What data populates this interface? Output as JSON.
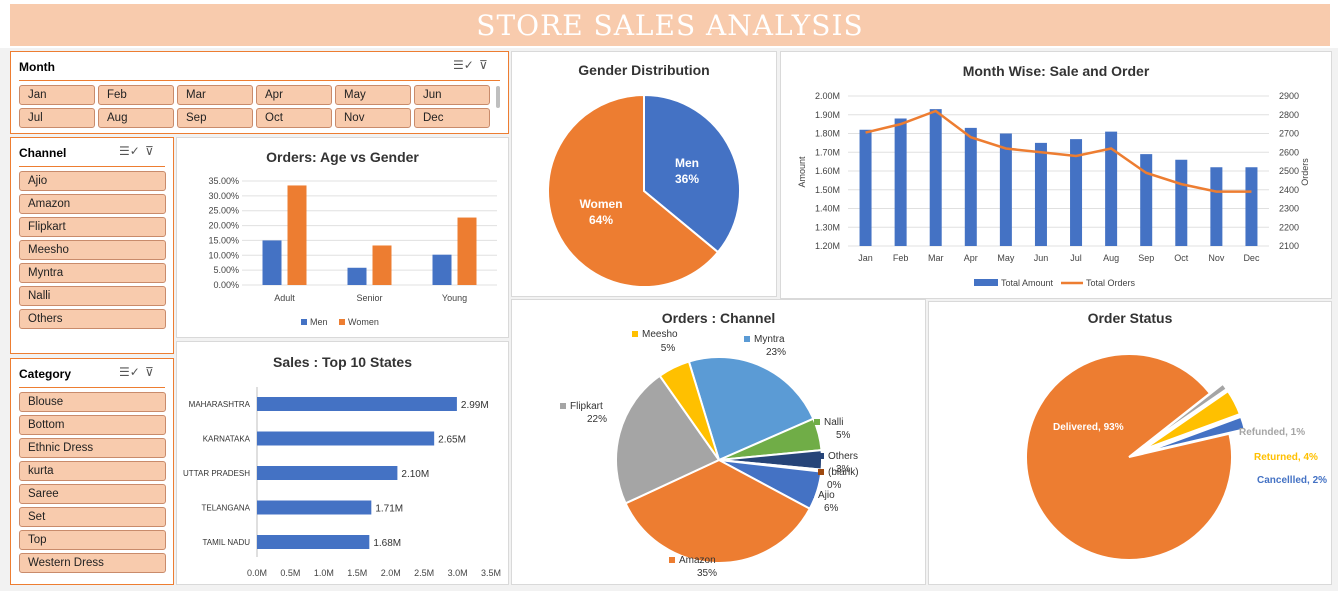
{
  "title": "STORE SALES ANALYSIS",
  "slicers": {
    "month": {
      "title": "Month",
      "items": [
        "Jan",
        "Feb",
        "Mar",
        "Apr",
        "May",
        "Jun",
        "Jul",
        "Aug",
        "Sep",
        "Oct",
        "Nov",
        "Dec"
      ]
    },
    "channel": {
      "title": "Channel",
      "items": [
        "Ajio",
        "Amazon",
        "Flipkart",
        "Meesho",
        "Myntra",
        "Nalli",
        "Others"
      ]
    },
    "category": {
      "title": "Category",
      "items": [
        "Blouse",
        "Bottom",
        "Ethnic Dress",
        "kurta",
        "Saree",
        "Set",
        "Top",
        "Western Dress"
      ]
    }
  },
  "colors": {
    "men": "#4472c4",
    "women": "#ed7d31",
    "banner": "#f8cbad",
    "slicer_border": "#ed7d31"
  },
  "chart_data": [
    {
      "id": "age_gender",
      "type": "bar",
      "title": "Orders: Age vs Gender",
      "categories": [
        "Adult",
        "Senior",
        "Young"
      ],
      "series": [
        {
          "name": "Men",
          "values": [
            15.0,
            5.8,
            10.2
          ]
        },
        {
          "name": "Women",
          "values": [
            33.5,
            13.3,
            22.7
          ]
        }
      ],
      "ylim": [
        0,
        35
      ],
      "y_ticks": [
        "0.00%",
        "5.00%",
        "10.00%",
        "15.00%",
        "20.00%",
        "25.00%",
        "30.00%",
        "35.00%"
      ],
      "legend": "bottom"
    },
    {
      "id": "gender_distribution",
      "type": "pie",
      "title": "Gender Distribution",
      "slices": [
        {
          "label": "Men",
          "value": 36,
          "text": "36%"
        },
        {
          "label": "Women",
          "value": 64,
          "text": "64%"
        }
      ]
    },
    {
      "id": "month_sale_order",
      "type": "bar",
      "title": "Month Wise: Sale and Order",
      "categories": [
        "Jan",
        "Feb",
        "Mar",
        "Apr",
        "May",
        "Jun",
        "Jul",
        "Aug",
        "Sep",
        "Oct",
        "Nov",
        "Dec"
      ],
      "series": [
        {
          "name": "Total Amount",
          "values": [
            1.82,
            1.88,
            1.93,
            1.83,
            1.8,
            1.75,
            1.77,
            1.81,
            1.69,
            1.66,
            1.62,
            1.62
          ]
        },
        {
          "name": "Total Orders",
          "type": "line",
          "values": [
            2705,
            2750,
            2820,
            2680,
            2620,
            2600,
            2580,
            2620,
            2490,
            2430,
            2390,
            2390
          ]
        }
      ],
      "ylabel": "Amount",
      "y2label": "Orders",
      "ylim": [
        1.2,
        2.0
      ],
      "y2lim": [
        2100,
        2900
      ],
      "y_ticks": [
        "1.20M",
        "1.30M",
        "1.40M",
        "1.50M",
        "1.60M",
        "1.70M",
        "1.80M",
        "1.90M",
        "2.00M"
      ],
      "y2_ticks": [
        "2100",
        "2200",
        "2300",
        "2400",
        "2500",
        "2600",
        "2700",
        "2800",
        "2900"
      ],
      "legend": "bottom"
    },
    {
      "id": "top_states",
      "type": "bar",
      "title": "Sales : Top 10 States",
      "orientation": "horizontal",
      "categories": [
        "MAHARASHTRA",
        "KARNATAKA",
        "UTTAR PRADESH",
        "TELANGANA",
        "TAMIL NADU"
      ],
      "values": [
        2.99,
        2.65,
        2.1,
        1.71,
        1.68
      ],
      "value_labels": [
        "2.99M",
        "2.65M",
        "2.10M",
        "1.71M",
        "1.68M"
      ],
      "xlim": [
        0,
        3.5
      ],
      "x_ticks": [
        "0.0M",
        "0.5M",
        "1.0M",
        "1.5M",
        "2.0M",
        "2.5M",
        "3.0M",
        "3.5M"
      ]
    },
    {
      "id": "orders_channel",
      "type": "pie",
      "title": "Orders : Channel",
      "slices": [
        {
          "label": "Myntra",
          "value": 23,
          "text": "23%",
          "color": "#5b9bd5"
        },
        {
          "label": "Nalli",
          "value": 5,
          "text": "5%",
          "color": "#70ad47"
        },
        {
          "label": "Others",
          "value": 3,
          "text": "3%",
          "color": "#264478"
        },
        {
          "label": "(blank)",
          "value": 0.3,
          "text": "0%",
          "color": "#9e480e"
        },
        {
          "label": "Ajio",
          "value": 6,
          "text": "6%",
          "color": "#4472c4"
        },
        {
          "label": "Amazon",
          "value": 35,
          "text": "35%",
          "color": "#ed7d31"
        },
        {
          "label": "Flipkart",
          "value": 22,
          "text": "22%",
          "color": "#a5a5a5"
        },
        {
          "label": "Meesho",
          "value": 5,
          "text": "5%",
          "color": "#ffc000"
        }
      ]
    },
    {
      "id": "order_status",
      "type": "pie",
      "title": "Order Status",
      "slices": [
        {
          "label": "Delivered",
          "value": 93,
          "text": "Delivered, 93%",
          "color": "#ed7d31"
        },
        {
          "label": "Refunded",
          "value": 1,
          "text": "Refunded, 1%",
          "color": "#a5a5a5"
        },
        {
          "label": "Returned",
          "value": 4,
          "text": "Returned, 4%",
          "color": "#ffc000"
        },
        {
          "label": "Cancellled",
          "value": 2,
          "text": "Cancellled, 2%",
          "color": "#4472c4"
        }
      ]
    }
  ]
}
